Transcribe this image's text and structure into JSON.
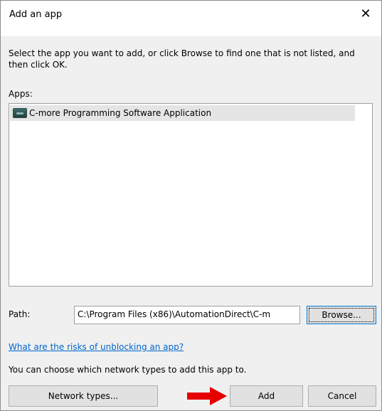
{
  "dialog": {
    "title": "Add an app",
    "close_glyph": "✕",
    "description": "Select the app you want to add, or click Browse to find one that is not listed, and then click OK.",
    "apps_label": "Apps:",
    "apps": [
      {
        "name": "C-more Programming Software Application",
        "icon": "c-more-app-icon"
      }
    ],
    "path_label": "Path:",
    "path_value": "C:\\Program Files (x86)\\AutomationDirect\\C-m",
    "browse_label": "Browse...",
    "risk_link": "What are the risks of unblocking an app?",
    "network_text": "You can choose which network types to add this app to.",
    "buttons": {
      "network_types": "Network types...",
      "add": "Add",
      "cancel": "Cancel"
    },
    "annotation": {
      "arrow_color": "#e60000",
      "icon": "red-arrow-icon"
    }
  }
}
